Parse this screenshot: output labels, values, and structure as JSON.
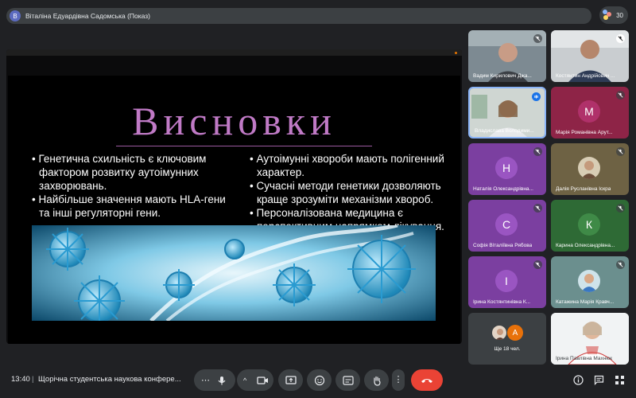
{
  "presenter": {
    "avatar_letter": "В",
    "label": "Віталіна Едуардівна Садомська (Показ)"
  },
  "people_count": "30",
  "slide": {
    "title": "Висновки",
    "left_bullets": [
      "• Генетична схильність є ключовим фактором розвитку аутоімунних захворювань.",
      "• Найбільше значення мають HLA-гени та інші регуляторні гени."
    ],
    "right_bullets": [
      "• Аутоімунні хвороби мають полігенний характер.",
      "• Сучасні методи генетики дозволяють краще зрозуміти механізми хвороб.",
      "• Персоналізована медицина є перспективним напрямком лікування."
    ]
  },
  "participants": [
    {
      "name": "Вадим Кирилович Джа...",
      "type": "video"
    },
    {
      "name": "Костянтин Андрійович ...",
      "type": "video"
    },
    {
      "name": "Владислава Володими...",
      "type": "video"
    },
    {
      "name": "Марія Романівна Арут...",
      "letter": "М"
    },
    {
      "name": "Наталія Олександрівна...",
      "letter": "Н"
    },
    {
      "name": "Далія Русланівна Іскра",
      "type": "photo"
    },
    {
      "name": "Софія Віталіївна Рябова",
      "letter": "С"
    },
    {
      "name": "Карина Олександрівна...",
      "letter": "К"
    },
    {
      "name": "Ірина Костянтинівна К...",
      "letter": "І"
    },
    {
      "name": "Катажина Марія Кравч...",
      "type": "photo"
    },
    {
      "name": "Ірина Павлівна Махнюк",
      "type": "video"
    }
  ],
  "more_tile": {
    "avatar_letter": "А",
    "label": "Ще 18 чел."
  },
  "bottom": {
    "time": "13:40",
    "separator": "|",
    "meeting_title": "Щорічна студентська наукова конфере..."
  },
  "colors": {
    "background": "#202124",
    "control": "#3c4043",
    "hangup": "#ea4335",
    "title": "#c07ac6",
    "tile_purple": "#7b3fa0",
    "tile_maroon": "#8e2447",
    "tile_green": "#2e6a35",
    "tile_teal": "#6b8f8e"
  }
}
